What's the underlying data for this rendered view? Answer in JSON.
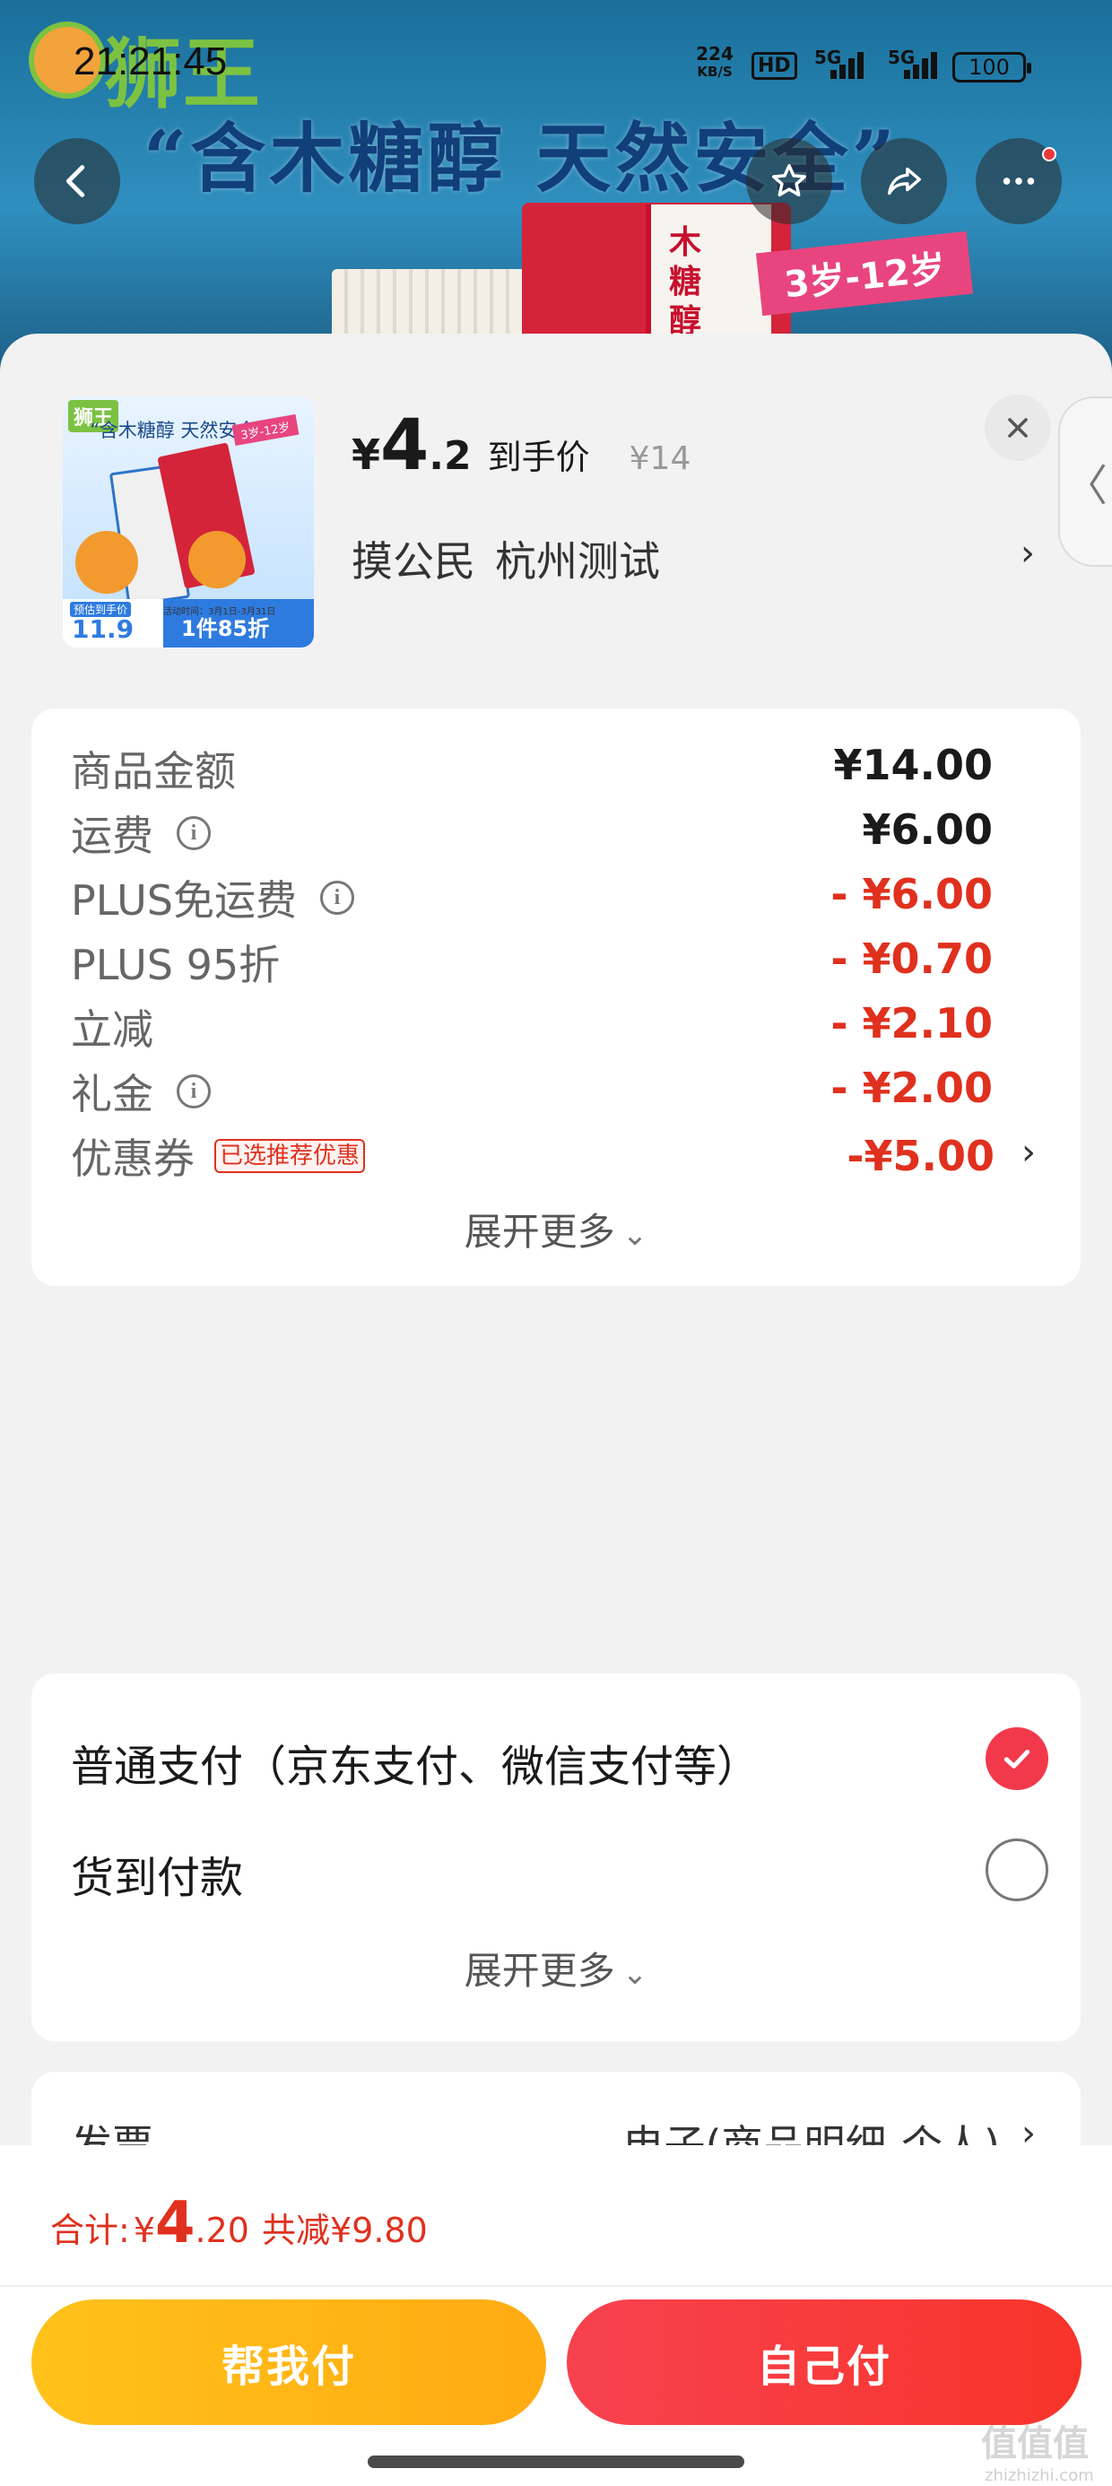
{
  "status_bar": {
    "time": "21:21:45",
    "net_speed_value": "224",
    "net_speed_unit": "KB/S",
    "hd": "HD",
    "sim1": "5G",
    "sim2": "5G",
    "battery": "100"
  },
  "banner": {
    "brand_logo": "狮王",
    "slogan": "“含木糖醇 天然安全”",
    "box_text": "木糖醇儿",
    "age_ribbon": "3岁-12岁"
  },
  "product": {
    "thumb": {
      "logo": "狮王",
      "slogan": "“含木糖醇 天然安全”",
      "ribbon": "3岁-12岁",
      "pre_label": "预估到手价",
      "pre_price": "11.9",
      "deal": "1件85折",
      "date_text": "活动时间：3月1日-3月31日"
    },
    "price_symbol": "¥",
    "price_int": "4",
    "price_dec": ".2",
    "price_tag": "到手价",
    "original_price": "¥14",
    "address_name": "摸公民",
    "address_city": "杭州测试"
  },
  "fees": [
    {
      "label": "商品金额",
      "value": "¥14.00",
      "info": false,
      "badge": "",
      "red": false
    },
    {
      "label": "运费",
      "value": "¥6.00",
      "info": true,
      "badge": "",
      "red": false
    },
    {
      "label": "PLUS免运费",
      "value": "- ¥6.00",
      "info": true,
      "badge": "",
      "red": true
    },
    {
      "label": "PLUS 95折",
      "value": "- ¥0.70",
      "info": false,
      "badge": "",
      "red": true
    },
    {
      "label": "立减",
      "value": "- ¥2.10",
      "info": false,
      "badge": "",
      "red": true
    },
    {
      "label": "礼金",
      "value": "- ¥2.00",
      "info": true,
      "badge": "",
      "red": true
    },
    {
      "label": "优惠券",
      "value": "-¥5.00",
      "info": false,
      "badge": "已选推荐优惠",
      "red": true
    }
  ],
  "fees_expand": "展开更多",
  "payment": {
    "options": [
      {
        "label": "普通支付（京东支付、微信支付等）",
        "selected": true
      },
      {
        "label": "货到付款",
        "selected": false
      }
    ],
    "expand": "展开更多"
  },
  "invoice": {
    "label": "发票",
    "value": "电子(商品明细-个人)"
  },
  "footer": {
    "total_label": "合计:",
    "total_symbol": "¥",
    "total_int": "4",
    "total_dec": ".20",
    "saved": "共减¥9.80",
    "help_pay": "帮我付",
    "self_pay": "自己付"
  },
  "watermark": {
    "brand": "值值值",
    "url": "zhizhizhi.com"
  },
  "colors": {
    "accent_red": "#e0301e",
    "pay_red": "#f2394b",
    "help_yellow": "#ffb515"
  }
}
